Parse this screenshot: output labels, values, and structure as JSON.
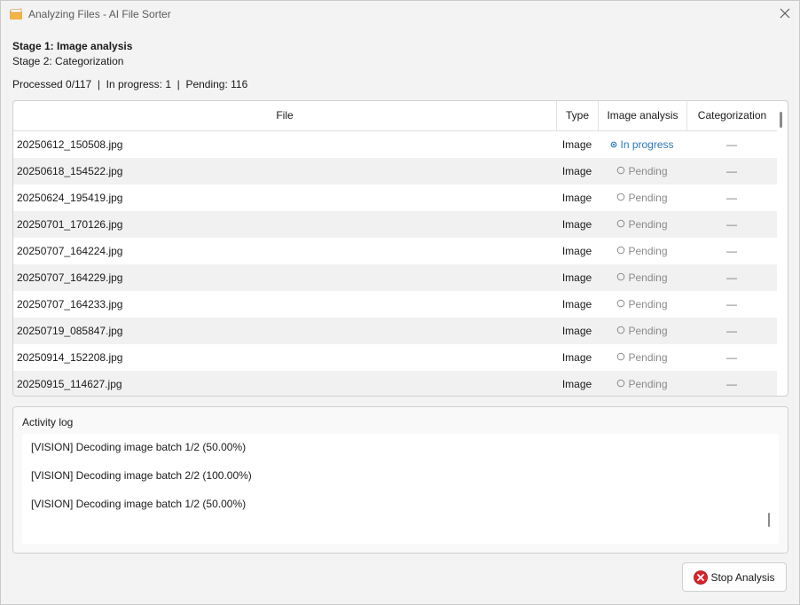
{
  "window": {
    "title": "Analyzing Files - AI File Sorter"
  },
  "stages": {
    "stage1": "Stage 1: Image analysis",
    "stage2": "Stage 2: Categorization"
  },
  "counts": "Processed 0/117  |  In progress: 1  |  Pending: 116",
  "table": {
    "columns": [
      "File",
      "Type",
      "Image analysis",
      "Categorization"
    ],
    "rows": [
      {
        "file": "20250612_150508.jpg",
        "type": "Image",
        "image_analysis": "In progress",
        "categorization": "—"
      },
      {
        "file": "20250618_154522.jpg",
        "type": "Image",
        "image_analysis": "Pending",
        "categorization": "—"
      },
      {
        "file": "20250624_195419.jpg",
        "type": "Image",
        "image_analysis": "Pending",
        "categorization": "—"
      },
      {
        "file": "20250701_170126.jpg",
        "type": "Image",
        "image_analysis": "Pending",
        "categorization": "—"
      },
      {
        "file": "20250707_164224.jpg",
        "type": "Image",
        "image_analysis": "Pending",
        "categorization": "—"
      },
      {
        "file": "20250707_164229.jpg",
        "type": "Image",
        "image_analysis": "Pending",
        "categorization": "—"
      },
      {
        "file": "20250707_164233.jpg",
        "type": "Image",
        "image_analysis": "Pending",
        "categorization": "—"
      },
      {
        "file": "20250719_085847.jpg",
        "type": "Image",
        "image_analysis": "Pending",
        "categorization": "—"
      },
      {
        "file": "20250914_152208.jpg",
        "type": "Image",
        "image_analysis": "Pending",
        "categorization": "—"
      },
      {
        "file": "20250915_114627.jpg",
        "type": "Image",
        "image_analysis": "Pending",
        "categorization": "—"
      }
    ]
  },
  "activity_log": {
    "title": "Activity log",
    "lines": [
      "[VISION] Decoding image batch 1/2 (50.00%)",
      "[VISION] Decoding image batch 2/2 (100.00%)",
      "[VISION] Decoding image batch 1/2 (50.00%)"
    ]
  },
  "buttons": {
    "stop": "Stop Analysis"
  },
  "colors": {
    "in_progress": "#2a7ab8",
    "pending": "#8a8a8a",
    "stop_icon": "#d9242c",
    "row_alt": "#f1f1f1"
  },
  "icons": {
    "app": "folder-icon",
    "close": "close-icon",
    "in_progress": "in-progress-icon",
    "pending": "pending-circle-icon",
    "stop": "stop-icon"
  }
}
